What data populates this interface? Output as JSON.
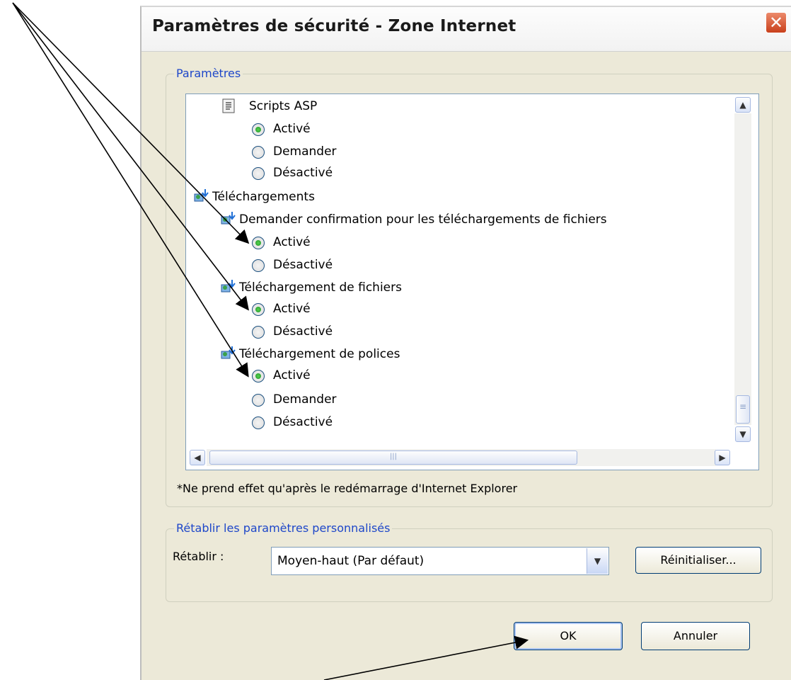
{
  "window": {
    "title": "Paramètres de sécurité - Zone Internet",
    "close_symbol": "✕"
  },
  "settings_group": {
    "label": "Paramètres"
  },
  "settings_list": {
    "scripts_asp": "Scripts ASP",
    "asp_opt_1": "Activé",
    "asp_opt_2": "Demander",
    "asp_opt_3": "Désactivé",
    "downloads": "Téléchargements",
    "confirm_downloads": "Demander confirmation pour les téléchargements de fichiers",
    "confirm_opt_1": "Activé",
    "confirm_opt_2": "Désactivé",
    "file_download": "Téléchargement de fichiers",
    "file_opt_1": "Activé",
    "file_opt_2": "Désactivé",
    "font_download": "Téléchargement de polices",
    "font_opt_1": "Activé",
    "font_opt_2": "Demander",
    "font_opt_3": "Désactivé"
  },
  "footnote": "*Ne prend effet qu'après le redémarrage d'Internet Explorer",
  "reset_group": {
    "label": "Rétablir les paramètres personnalisés"
  },
  "reset": {
    "label": "Rétablir :",
    "select_value": "Moyen-haut (Par défaut)",
    "reset_button": "Réinitialiser..."
  },
  "buttons": {
    "ok": "OK",
    "cancel": "Annuler"
  },
  "scrollbar": {
    "up": "▲",
    "down": "▼",
    "left": "◀",
    "right": "▶",
    "grip": "≡",
    "hgrip": "|||"
  },
  "colors": {
    "group_label": "#1e47c9",
    "dialog_bg": "#ece9d8",
    "radio_selected": "#2aa832"
  }
}
